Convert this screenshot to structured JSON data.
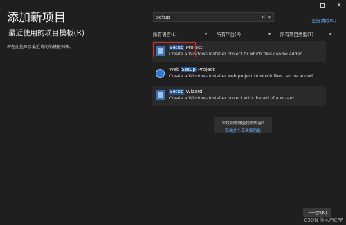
{
  "window": {
    "controls": [
      "□",
      "✕"
    ]
  },
  "header": {
    "title": "添加新项目",
    "recent_heading": "最近使用的项目模板(R)",
    "recent_hint": "将在此处显示最近访问的模板列表。"
  },
  "search": {
    "value": "setup",
    "clear_label": "全部清除(C)"
  },
  "filters": [
    {
      "label": "所有语言(L)"
    },
    {
      "label": "所有平台(P)"
    },
    {
      "label": "所有项目类型(T)"
    }
  ],
  "results": [
    {
      "name_pre": "",
      "name_hl": "Setup",
      "name_post": " Project",
      "desc": "Create a Windows Installer project to which files can be added"
    },
    {
      "name_pre": "Web ",
      "name_hl": "Setup",
      "name_post": " Project",
      "desc": "Create a Windows Installer web project to which files can be added"
    },
    {
      "name_pre": "",
      "name_hl": "Setup",
      "name_post": " Wizard",
      "desc": "Create a Windows Installer project with the aid of a wizard."
    }
  ],
  "not_found": {
    "question": "未找到你要查找的内容?",
    "link": "安装多个工具和功能"
  },
  "footer": {
    "next_label": "下一步(N)",
    "watermark": "CSDN @木白CPP"
  },
  "colors": {
    "background": "#1f1f1f",
    "accent_link": "#6ab0ff",
    "highlight": "#1e4f8a",
    "annotation_red": "#d12b2b"
  }
}
